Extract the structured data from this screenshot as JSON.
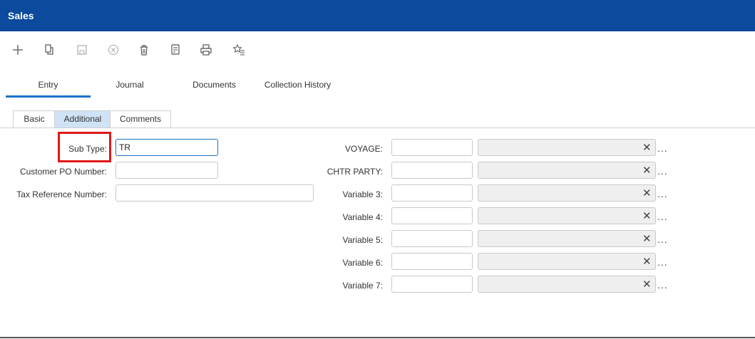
{
  "window": {
    "title": "Sales"
  },
  "toolbar": {
    "icons": [
      "plus-icon",
      "copy-icon",
      "save-icon",
      "cancel-icon",
      "delete-icon",
      "notes-icon",
      "print-icon",
      "favorite-icon"
    ]
  },
  "tabs": [
    {
      "label": "Entry",
      "active": true
    },
    {
      "label": "Journal",
      "active": false
    },
    {
      "label": "Documents",
      "active": false
    },
    {
      "label": "Collection History",
      "active": false
    }
  ],
  "subtabs": [
    {
      "label": "Basic",
      "active": false
    },
    {
      "label": "Additional",
      "active": true
    },
    {
      "label": "Comments",
      "active": false
    }
  ],
  "form_left": {
    "sub_type": {
      "label": "Sub Type:",
      "value": "TR"
    },
    "customer_po": {
      "label": "Customer PO Number:",
      "value": ""
    },
    "tax_ref": {
      "label": "Tax Reference Number:",
      "value": ""
    }
  },
  "form_right": [
    {
      "label": "VOYAGE:",
      "value": "",
      "description": ""
    },
    {
      "label": "CHTR PARTY:",
      "value": "",
      "description": ""
    },
    {
      "label": "Variable 3:",
      "value": "",
      "description": ""
    },
    {
      "label": "Variable 4:",
      "value": "",
      "description": ""
    },
    {
      "label": "Variable 5:",
      "value": "",
      "description": ""
    },
    {
      "label": "Variable 6:",
      "value": "",
      "description": ""
    },
    {
      "label": "Variable 7:",
      "value": "",
      "description": ""
    }
  ],
  "glyphs": {
    "clear": "✕",
    "more": "..."
  },
  "colors": {
    "titlebar": "#0b4a9c",
    "active_tab_underline": "#1a73c9",
    "active_subtab": "#cfe2f6",
    "highlight": "#e01818"
  }
}
